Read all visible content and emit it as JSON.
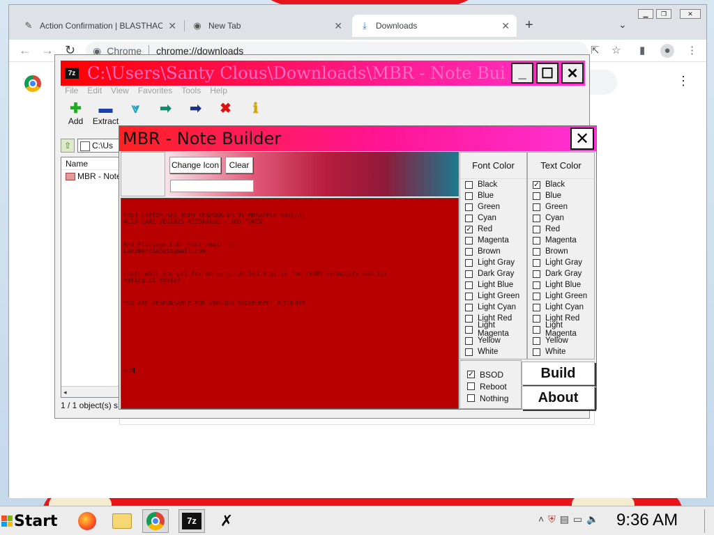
{
  "browser": {
    "tabs": [
      {
        "title": "Action Confirmation | BLASTHAC",
        "icon": "hacker-icon",
        "active": false
      },
      {
        "title": "New Tab",
        "icon": "chrome-icon",
        "active": false
      },
      {
        "title": "Downloads",
        "icon": "download-icon",
        "active": true
      }
    ],
    "omnibox": {
      "site_chip": "Chrome",
      "url": "chrome://downloads"
    }
  },
  "sevenzip": {
    "title": "C:\\Users\\Santy Clous\\Downloads\\MBR - Note Buil...",
    "badge": "7z",
    "menu": [
      "File",
      "Edit",
      "View",
      "Favorites",
      "Tools",
      "Help"
    ],
    "toolbar": [
      {
        "label": "Add",
        "icon": "plus-icon",
        "color": "#22aa22"
      },
      {
        "label": "Extract",
        "icon": "minus-icon",
        "color": "#1a3fb0"
      },
      {
        "label": "",
        "icon": "check-icon",
        "color": "#1aa5c8"
      },
      {
        "label": "",
        "icon": "copy-arrow-icon",
        "color": "#138a6a"
      },
      {
        "label": "",
        "icon": "move-arrow-icon",
        "color": "#1a2f8a"
      },
      {
        "label": "",
        "icon": "delete-icon",
        "color": "#dd1111"
      },
      {
        "label": "",
        "icon": "info-icon",
        "color": "#d4a800"
      }
    ],
    "path": "C:\\Us",
    "column_name": "Name",
    "file": "MBR - Note",
    "status": "1 / 1 object(s) s"
  },
  "mbr": {
    "title": "MBR - Note Builder",
    "change_icon_label": "Change Icon",
    "clear_label": "Clear",
    "note_lines": [
      "YOUR LAPTOP HAS BEEN KERPUNKLED BY MBRAPPLE OJ(C/A)\nACID CARE VEGIBIS HEIDARAGE / ROD TOKEN",
      "Red Flamingo Lab. Your email is:\nLamumerciaboto@mail.com",
      "thats what you get for be as a spoiled brat in the /VGMT community and for\nmaking it toxic!",
      "YOU ARE RESPONSABLE FOR VARIOUS SOCKPUPPET ACCOUNTS"
    ],
    "note_end": "end",
    "font_color": {
      "header": "Font Color",
      "options": [
        "Black",
        "Blue",
        "Green",
        "Cyan",
        "Red",
        "Magenta",
        "Brown",
        "Light Gray",
        "Dark Gray",
        "Light Blue",
        "Light Green",
        "Light Cyan",
        "Light Red",
        "Light Magenta",
        "Yellow",
        "White"
      ],
      "selected": "Red"
    },
    "text_color": {
      "header": "Text Color",
      "options": [
        "Black",
        "Blue",
        "Green",
        "Cyan",
        "Red",
        "Magenta",
        "Brown",
        "Light Gray",
        "Dark Gray",
        "Light Blue",
        "Light Green",
        "Light Cyan",
        "Light Red",
        "Light Magenta",
        "Yellow",
        "White"
      ],
      "selected": "Black"
    },
    "actions": [
      {
        "label": "BSOD",
        "checked": true
      },
      {
        "label": "Reboot",
        "checked": false
      },
      {
        "label": "Nothing",
        "checked": false
      }
    ],
    "build_label": "Build",
    "about_label": "About"
  },
  "taskbar": {
    "start_label": "Start",
    "apps": [
      "firefox-icon",
      "file-explorer-icon",
      "chrome-icon",
      "7zip-icon",
      "mbr-builder-icon"
    ],
    "clock": "9:36 AM"
  }
}
